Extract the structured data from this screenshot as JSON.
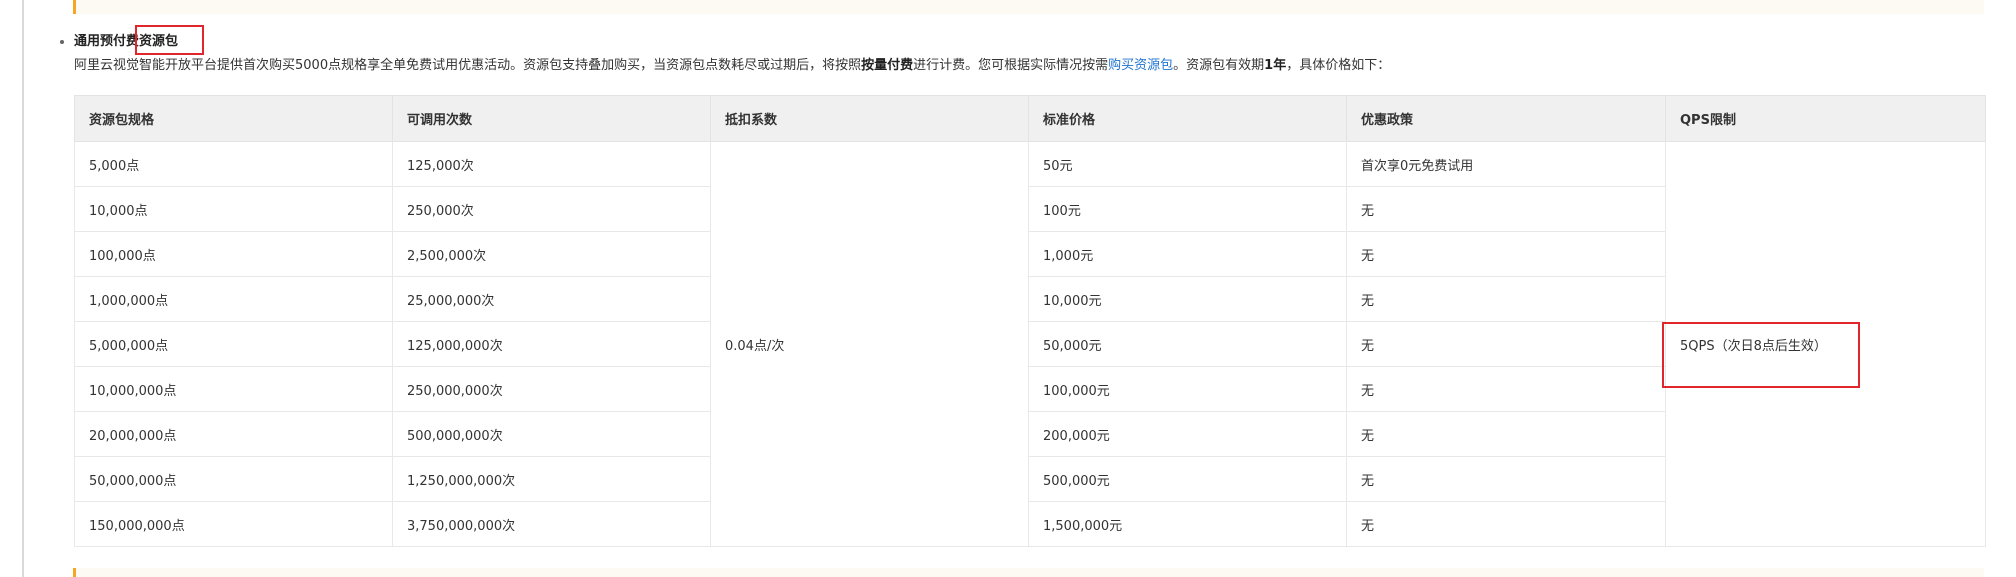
{
  "section": {
    "title": "通用预付费资源包",
    "description": {
      "part1": "阿里云视觉智能开放平台提供首次购买5000点规格享全单免费试用优惠活动。资源包支持叠加购买，当资源包点数耗尽或过期后，将按照",
      "bold1": "按量付费",
      "part2": "进行计费。您可根据实际情况按需",
      "link": "购买资源包",
      "part3": "。资源包有效期",
      "bold2": "1年",
      "part4": "，具体价格如下："
    }
  },
  "table": {
    "headers": [
      "资源包规格",
      "可调用次数",
      "抵扣系数",
      "标准价格",
      "优惠政策",
      "QPS限制"
    ],
    "coefficient": "0.04点/次",
    "qps": "5QPS（次日8点后生效）",
    "rows": [
      {
        "spec": "5,000点",
        "calls": "125,000次",
        "price": "50元",
        "discount": "首次享0元免费试用"
      },
      {
        "spec": "10,000点",
        "calls": "250,000次",
        "price": "100元",
        "discount": "无"
      },
      {
        "spec": "100,000点",
        "calls": "2,500,000次",
        "price": "1,000元",
        "discount": "无"
      },
      {
        "spec": "1,000,000点",
        "calls": "25,000,000次",
        "price": "10,000元",
        "discount": "无"
      },
      {
        "spec": "5,000,000点",
        "calls": "125,000,000次",
        "price": "50,000元",
        "discount": "无"
      },
      {
        "spec": "10,000,000点",
        "calls": "250,000,000次",
        "price": "100,000元",
        "discount": "无"
      },
      {
        "spec": "20,000,000点",
        "calls": "500,000,000次",
        "price": "200,000元",
        "discount": "无"
      },
      {
        "spec": "50,000,000点",
        "calls": "1,250,000,000次",
        "price": "500,000元",
        "discount": "无"
      },
      {
        "spec": "150,000,000点",
        "calls": "3,750,000,000次",
        "price": "1,500,000元",
        "discount": "无"
      }
    ]
  },
  "colors": {
    "annotation_box": "#e0262b",
    "link": "#1e73d1",
    "note_border": "#f5a623",
    "note_background": "#fdfaf3",
    "table_header_background": "#f0f0f0"
  }
}
